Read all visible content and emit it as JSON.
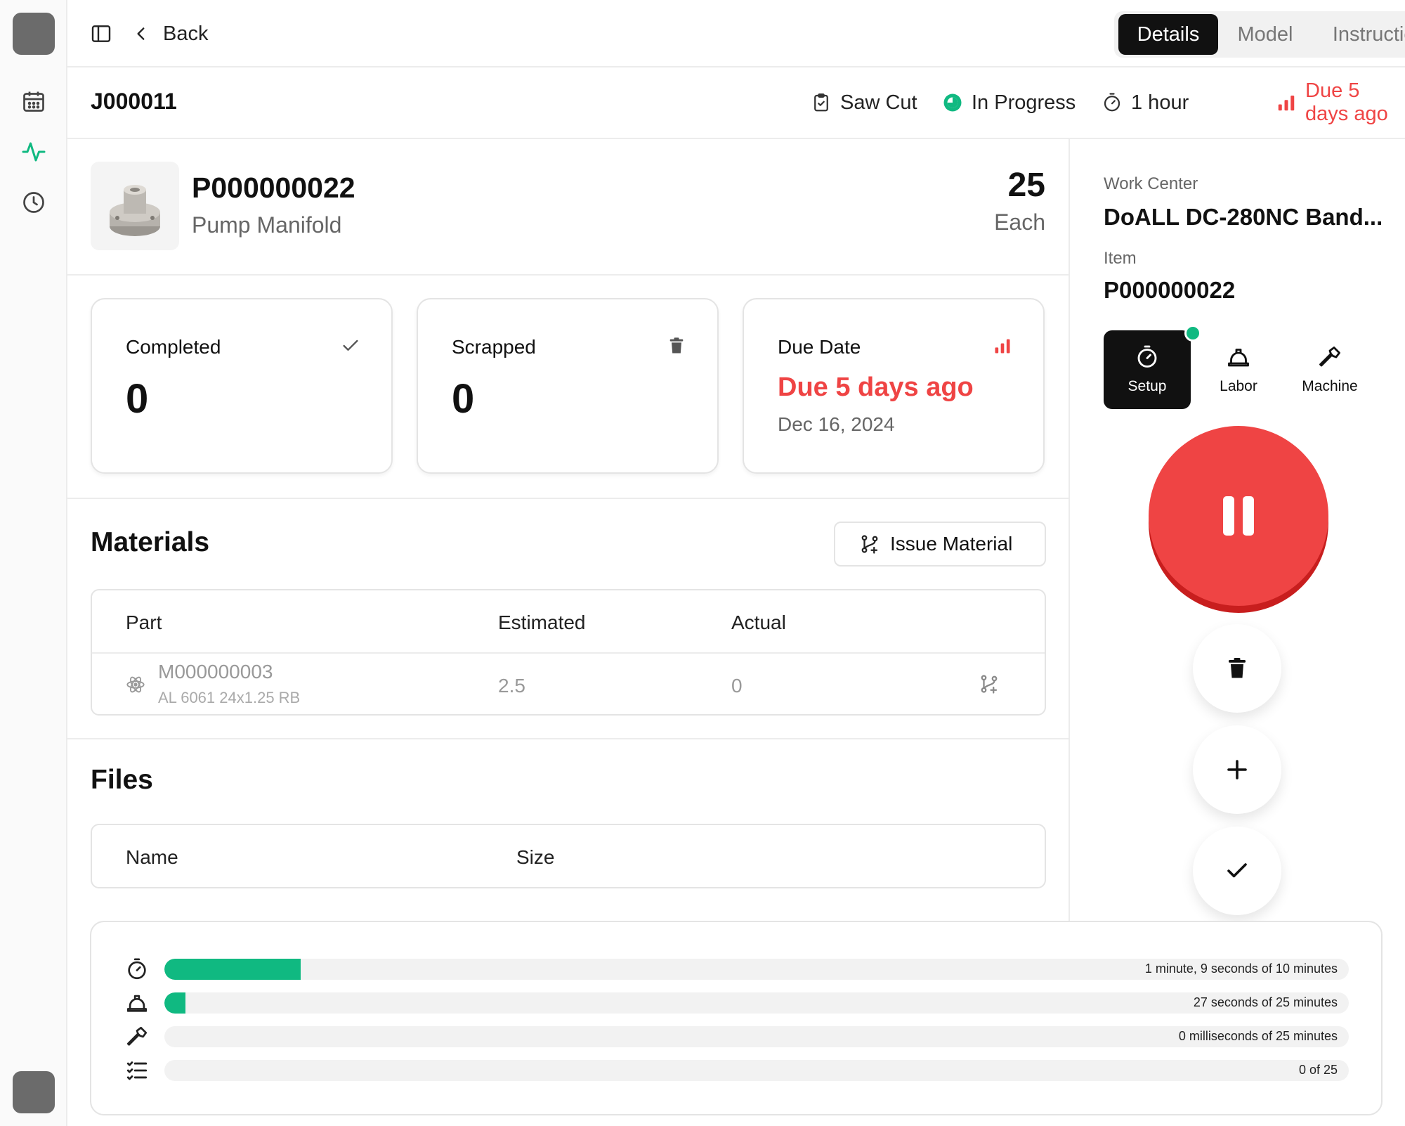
{
  "topbar": {
    "back_label": "Back",
    "tabs": [
      {
        "label": "Details",
        "active": true
      },
      {
        "label": "Model",
        "active": false
      },
      {
        "label": "Instructions",
        "active": false
      }
    ]
  },
  "job": {
    "id": "J000011",
    "process": "Saw Cut",
    "status": "In Progress",
    "duration": "1 hour",
    "due": "Due 5 days ago"
  },
  "item": {
    "part_number": "P000000022",
    "name": "Pump Manifold",
    "quantity": "25",
    "unit": "Each"
  },
  "cards": {
    "completed": {
      "title": "Completed",
      "value": "0"
    },
    "scrapped": {
      "title": "Scrapped",
      "value": "0"
    },
    "due_date": {
      "title": "Due Date",
      "relative": "Due 5 days ago",
      "date": "Dec 16, 2024"
    }
  },
  "materials": {
    "title": "Materials",
    "issue_button": "Issue Material",
    "columns": [
      "Part",
      "Estimated",
      "Actual"
    ],
    "rows": [
      {
        "part": "M000000003",
        "description": "AL 6061 24x1.25 RB",
        "estimated": "2.5",
        "actual": "0"
      }
    ]
  },
  "files": {
    "title": "Files",
    "columns": [
      "Name",
      "Size"
    ]
  },
  "side": {
    "work_center_label": "Work Center",
    "work_center": "DoALL DC-280NC Band...",
    "item_label": "Item",
    "item": "P000000022",
    "modes": [
      {
        "label": "Setup",
        "active": true
      },
      {
        "label": "Labor",
        "active": false
      },
      {
        "label": "Machine",
        "active": false
      }
    ]
  },
  "progress": [
    {
      "icon": "stopwatch-icon",
      "text": "1 minute, 9 seconds of 10 minutes",
      "fraction": 0.115
    },
    {
      "icon": "hard-hat-icon",
      "text": "27 seconds of 25 minutes",
      "fraction": 0.018
    },
    {
      "icon": "hammer-icon",
      "text": "0 milliseconds of 25 minutes",
      "fraction": 0
    },
    {
      "icon": "checklist-icon",
      "text": "0 of 25",
      "fraction": 0
    }
  ],
  "colors": {
    "accent_green": "#10b981",
    "danger_red": "#ef4444",
    "dark": "#111111"
  }
}
